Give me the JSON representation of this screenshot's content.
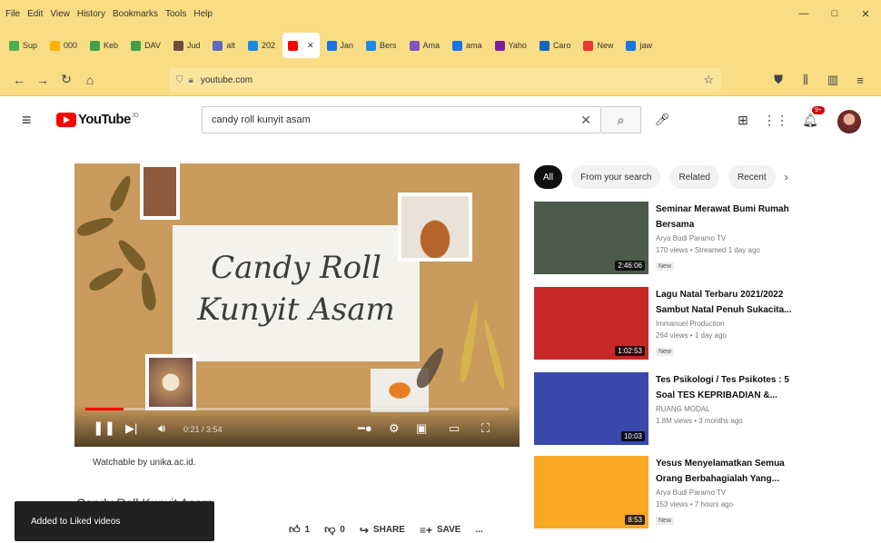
{
  "browser": {
    "menu": [
      "Edit",
      "View",
      "History",
      "Bookmarks",
      "Tools",
      "Help"
    ],
    "url_host": "youtube.com",
    "tabs": [
      {
        "label": "Sup",
        "color": "#4caf50"
      },
      {
        "label": "000",
        "color": "#ffb300"
      },
      {
        "label": "Keb",
        "color": "#43a047"
      },
      {
        "label": "DAV",
        "color": "#43a047"
      },
      {
        "label": "Jud",
        "color": "#6d4c41"
      },
      {
        "label": "alt",
        "color": "#5c6bc0"
      },
      {
        "label": "202",
        "color": "#1e88e5"
      },
      {
        "label": "",
        "color": "#ff0000",
        "active": true
      },
      {
        "label": "Jan",
        "color": "#1a73e8"
      },
      {
        "label": "Bers",
        "color": "#1e88e5"
      },
      {
        "label": "Ama",
        "color": "#7e57c2"
      },
      {
        "label": "ama",
        "color": "#1a73e8"
      },
      {
        "label": "Yaho",
        "color": "#7b1fa2"
      },
      {
        "label": "Caro",
        "color": "#1565c0"
      },
      {
        "label": "New",
        "color": "#e53935"
      },
      {
        "label": "jaw",
        "color": "#1a73e8"
      }
    ]
  },
  "youtube": {
    "logo_text": "YouTube",
    "search_value": "candy roll kunyit asam",
    "notification_count": "9+"
  },
  "video": {
    "title_art": [
      "Candy Roll",
      "Kunyit Asam"
    ],
    "time": "0:21 / 3:54",
    "progress": 0.09,
    "watchable_by": "Watchable by unika.ac.id.",
    "title": "Candy Roll Kunyit Asam",
    "likes": "1",
    "dislikes": "0",
    "share_label": "SHARE",
    "save_label": "SAVE",
    "more_label": "..."
  },
  "toast": {
    "text": "Added to Liked videos"
  },
  "chips": [
    "All",
    "From your search",
    "Related",
    "Recent"
  ],
  "recommendations": [
    {
      "title": "Seminar Merawat Bumi Rumah Bersama",
      "channel": "Arya Budi Paramo TV",
      "stats": "170 views • Streamed 1 day ago",
      "duration": "2:46:06",
      "badge": "New",
      "thumb": "#4b5a4b"
    },
    {
      "title": "Lagu Natal Terbaru 2021/2022 Sambut Natal Penuh Sukacita...",
      "channel": "Immanuel Production",
      "stats": "264 views • 1 day ago",
      "duration": "1:02:53",
      "badge": "New",
      "thumb": "#c62828"
    },
    {
      "title": "Tes Psikologi / Tes Psikotes : 5 Soal TES KEPRIBADIAN &...",
      "channel": "RUANG MODAL",
      "stats": "1.8M views • 3 months ago",
      "duration": "10:03",
      "badge": "",
      "thumb": "#3949ab"
    },
    {
      "title": "Yesus Menyelamatkan Semua Orang Berbahagialah Yang...",
      "channel": "Arya Budi Paramo TV",
      "stats": "153 views • 7 hours ago",
      "duration": "8:53",
      "badge": "New",
      "thumb": "#f9a825"
    }
  ]
}
